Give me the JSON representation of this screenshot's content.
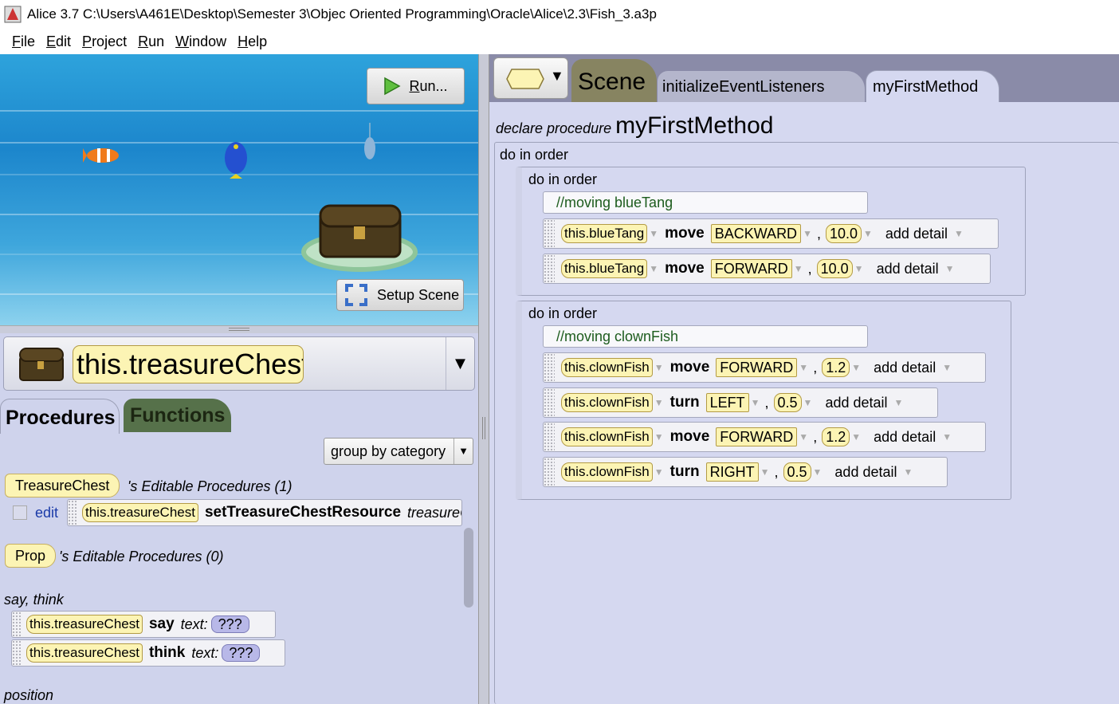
{
  "window": {
    "title": "Alice 3.7 C:\\Users\\A461E\\Desktop\\Semester 3\\Objec Oriented Programming\\Oracle\\Alice\\2.3\\Fish_3.a3p"
  },
  "menu": [
    {
      "key": "F",
      "rest": "ile"
    },
    {
      "key": "E",
      "rest": "dit"
    },
    {
      "key": "P",
      "rest": "roject"
    },
    {
      "key": "R",
      "rest": "un"
    },
    {
      "key": "W",
      "rest": "indow"
    },
    {
      "key": "H",
      "rest": "elp"
    }
  ],
  "scene": {
    "run_key": "R",
    "run_rest": "un...",
    "setup_label": "Setup Scene"
  },
  "object_selector": {
    "selected": "this.treasureChest"
  },
  "left_tabs": {
    "procedures": "Procedures",
    "functions": "Functions"
  },
  "group_by": {
    "value": "group by category"
  },
  "procedures": {
    "type_chip": "TreasureChest",
    "editable_label": "'s Editable Procedures (1)",
    "edit_link": "edit",
    "method_target": "this.treasureChest",
    "method_name": "setTreasureChestResource",
    "method_param": "treasureChest",
    "prop_chip": "Prop",
    "prop_label": "'s Editable Procedures (0)",
    "category_say": "say, think",
    "say_target": "this.treasureChest",
    "say_kw": "say",
    "think_target": "this.treasureChest",
    "think_kw": "think",
    "text_param": "text:",
    "text_value": "???",
    "category_position": "position"
  },
  "code_tabs": {
    "scene": "Scene",
    "init": "initializeEventListeners",
    "mine": "myFirstMethod"
  },
  "code": {
    "declare_label": "declare procedure",
    "method_name": "myFirstMethod",
    "do_in_order": "do in order",
    "comment1": "//moving blueTang",
    "comment2": "//moving clownFish",
    "add_detail": "add detail",
    "statements1": [
      {
        "target": "this.blueTang",
        "verb": "move",
        "dir": "BACKWARD",
        "amount": "10.0"
      },
      {
        "target": "this.blueTang",
        "verb": "move",
        "dir": "FORWARD",
        "amount": "10.0"
      }
    ],
    "statements2": [
      {
        "target": "this.clownFish",
        "verb": "move",
        "dir": "FORWARD",
        "amount": "1.2"
      },
      {
        "target": "this.clownFish",
        "verb": "turn",
        "dir": "LEFT",
        "amount": "0.5"
      },
      {
        "target": "this.clownFish",
        "verb": "move",
        "dir": "FORWARD",
        "amount": "1.2"
      },
      {
        "target": "this.clownFish",
        "verb": "turn",
        "dir": "RIGHT",
        "amount": "0.5"
      }
    ]
  }
}
